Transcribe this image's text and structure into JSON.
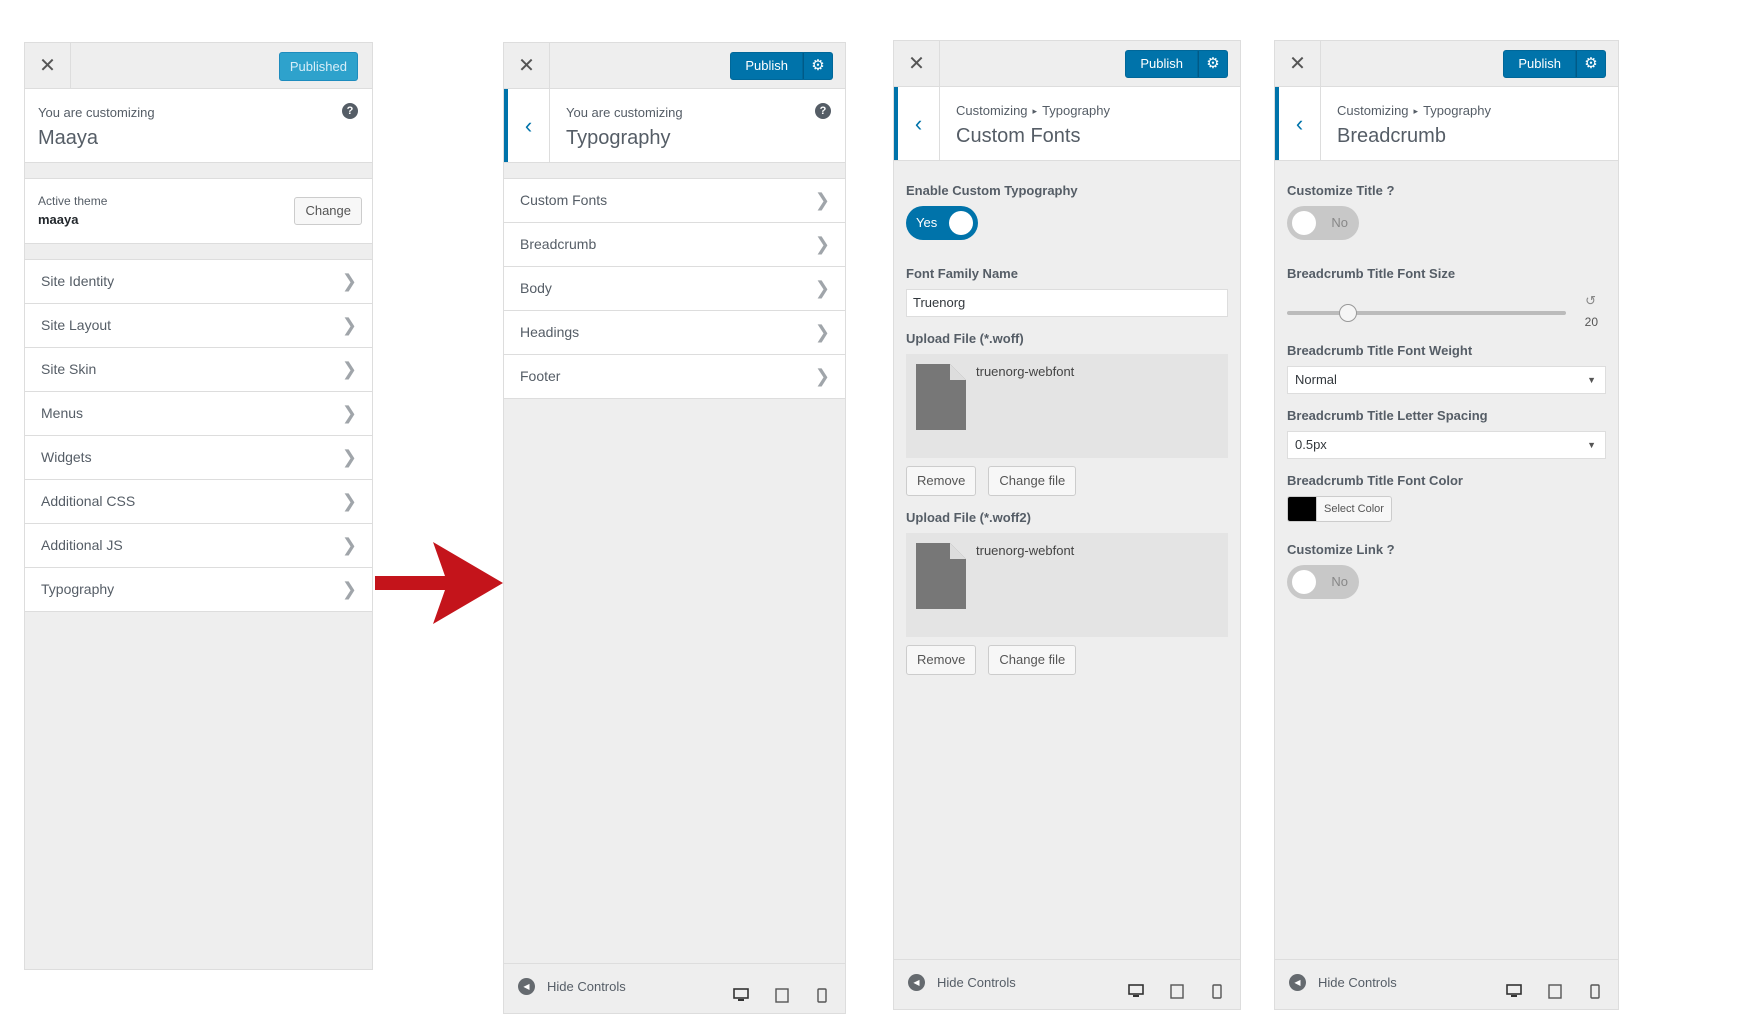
{
  "panel1": {
    "published_label": "Published",
    "customizing_small": "You are customizing",
    "customizing_big": "Maaya",
    "active_theme_label": "Active theme",
    "active_theme_name": "maaya",
    "change_label": "Change",
    "items": [
      {
        "label": "Site Identity"
      },
      {
        "label": "Site Layout"
      },
      {
        "label": "Site Skin"
      },
      {
        "label": "Menus"
      },
      {
        "label": "Widgets"
      },
      {
        "label": "Additional CSS"
      },
      {
        "label": "Additional JS"
      },
      {
        "label": "Typography"
      }
    ]
  },
  "panel2": {
    "publish_label": "Publish",
    "customizing_small": "You are customizing",
    "customizing_big": "Typography",
    "items": [
      {
        "label": "Custom Fonts"
      },
      {
        "label": "Breadcrumb"
      },
      {
        "label": "Body"
      },
      {
        "label": "Headings"
      },
      {
        "label": "Footer"
      }
    ],
    "hide_controls": "Hide Controls"
  },
  "panel3": {
    "publish_label": "Publish",
    "crumb_root": "Customizing",
    "crumb_section": "Typography",
    "title": "Custom Fonts",
    "enable_label": "Enable Custom Typography",
    "enable_value": "Yes",
    "font_family_label": "Font Family Name",
    "font_family_value": "Truenorg",
    "upload_woff_label": "Upload File (*.woff)",
    "upload_woff_file": "truenorg-webfont",
    "upload_woff2_label": "Upload File (*.woff2)",
    "upload_woff2_file": "truenorg-webfont",
    "remove_label": "Remove",
    "change_file_label": "Change file",
    "hide_controls": "Hide Controls"
  },
  "panel4": {
    "publish_label": "Publish",
    "crumb_root": "Customizing",
    "crumb_section": "Typography",
    "title": "Breadcrumb",
    "customize_title_label": "Customize Title ?",
    "customize_title_value": "No",
    "font_size_label": "Breadcrumb Title Font Size",
    "font_size_value": "20",
    "font_size_fraction": 0.22,
    "font_weight_label": "Breadcrumb Title Font Weight",
    "font_weight_value": "Normal",
    "letter_spacing_label": "Breadcrumb Title Letter Spacing",
    "letter_spacing_value": "0.5px",
    "font_color_label": "Breadcrumb Title Font Color",
    "font_color_value": "#000000",
    "select_color_label": "Select Color",
    "customize_link_label": "Customize Link ?",
    "customize_link_value": "No",
    "hide_controls": "Hide Controls"
  },
  "colors": {
    "accent": "#0073aa",
    "arrow": "#c4141b"
  }
}
